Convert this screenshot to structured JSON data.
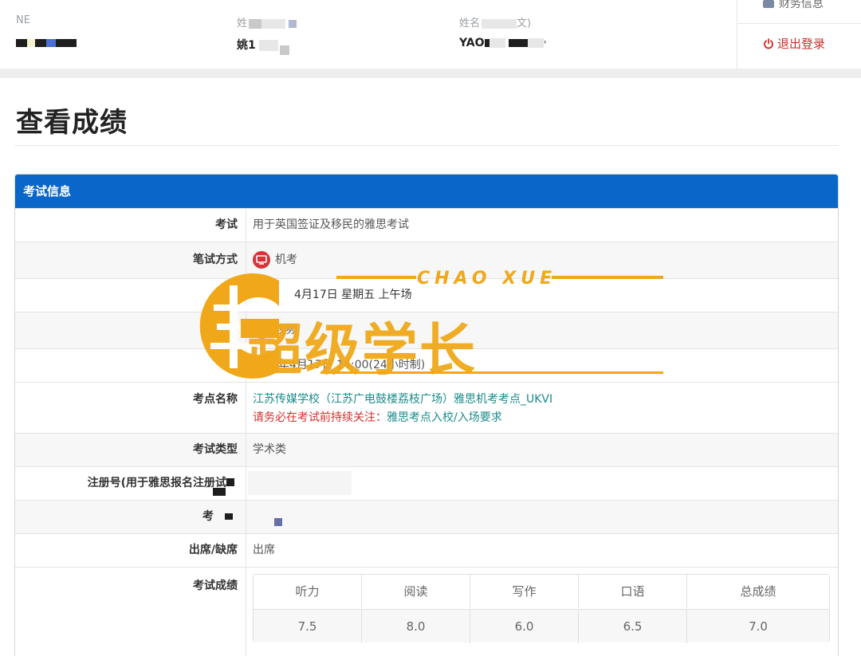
{
  "user_strip": {
    "col1": {
      "label": "NE",
      "value": ""
    },
    "col2": {
      "label": "姓",
      "value": "姚"
    },
    "col3": {
      "label": "姓名",
      "label_tail": "文)",
      "value": "YAO"
    }
  },
  "side_menu": {
    "finance_label": "财务信息",
    "logout_label": "退出登录"
  },
  "page": {
    "title": "查看成绩"
  },
  "exam_panel": {
    "header": "考试信息",
    "rows": [
      {
        "key": "考试",
        "value": "用于英国签证及移民的雅思考试"
      },
      {
        "key": "笔试方式",
        "value": "机考",
        "icon": "computer-icon"
      },
      {
        "key": "",
        "value": "4月17日 星期五 上午场"
      },
      {
        "key": "方式",
        "value": "视频"
      },
      {
        "key": "口",
        "value": "年4月17日 14:00(24小时制)"
      },
      {
        "key": "考点名称",
        "value": "江苏传媒学校（江苏广电鼓楼荔枝广场）雅思机考考点_UKVI",
        "notice_prefix": "请务必在考试前持续关注：",
        "notice_link": "雅思考点入校/入场要求"
      },
      {
        "key": "考试类型",
        "value": "学术类"
      },
      {
        "key": "注册号(用于雅思报名注册试",
        "value": ""
      },
      {
        "key": "考",
        "value": ""
      },
      {
        "key": "出席/缺席",
        "value": "出席"
      },
      {
        "key": "考试成绩",
        "value": ""
      }
    ],
    "scores": {
      "headers": [
        "听力",
        "阅读",
        "写作",
        "口语",
        "总成绩"
      ],
      "values": [
        "7.5",
        "8.0",
        "6.0",
        "6.5",
        "7.0"
      ]
    }
  },
  "watermark": {
    "text": "超级学长",
    "sub": "CHAO XUE",
    "color": "#f0a81a"
  },
  "colors": {
    "panel_header": "#0a66c8",
    "link": "#1a8a8a",
    "warning": "#d0312d"
  }
}
